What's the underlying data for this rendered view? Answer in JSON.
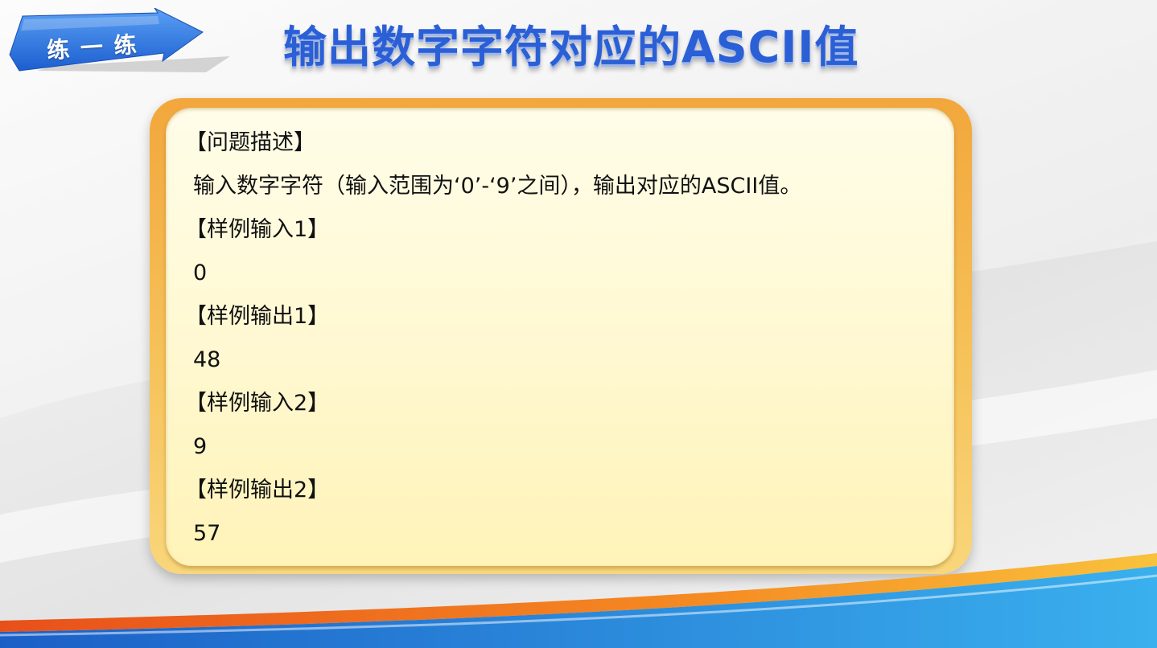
{
  "header": {
    "badge_label": "练 一 练",
    "title": "输出数字字符对应的ASCII值"
  },
  "problem": {
    "lines": [
      {
        "kind": "heading",
        "text": "【问题描述】"
      },
      {
        "kind": "body",
        "text": "输入数字字符（输入范围为‘0’-‘9’之间），输出对应的ASCII值。"
      },
      {
        "kind": "heading",
        "text": "【样例输入1】"
      },
      {
        "kind": "body",
        "text": "0"
      },
      {
        "kind": "heading",
        "text": "【样例输出1】"
      },
      {
        "kind": "body",
        "text": "48"
      },
      {
        "kind": "heading",
        "text": "【样例输入2】"
      },
      {
        "kind": "body",
        "text": "9"
      },
      {
        "kind": "heading",
        "text": "【样例输出2】"
      },
      {
        "kind": "body",
        "text": "57"
      }
    ]
  },
  "colors": {
    "title_blue": "#2a5fd6",
    "badge_blue": "#2a6fe0",
    "card_orange": "#f2a73c",
    "card_fill": "#fff8d0",
    "stripe_orange": "#f07a1e",
    "stripe_blue": "#1f78d6"
  }
}
